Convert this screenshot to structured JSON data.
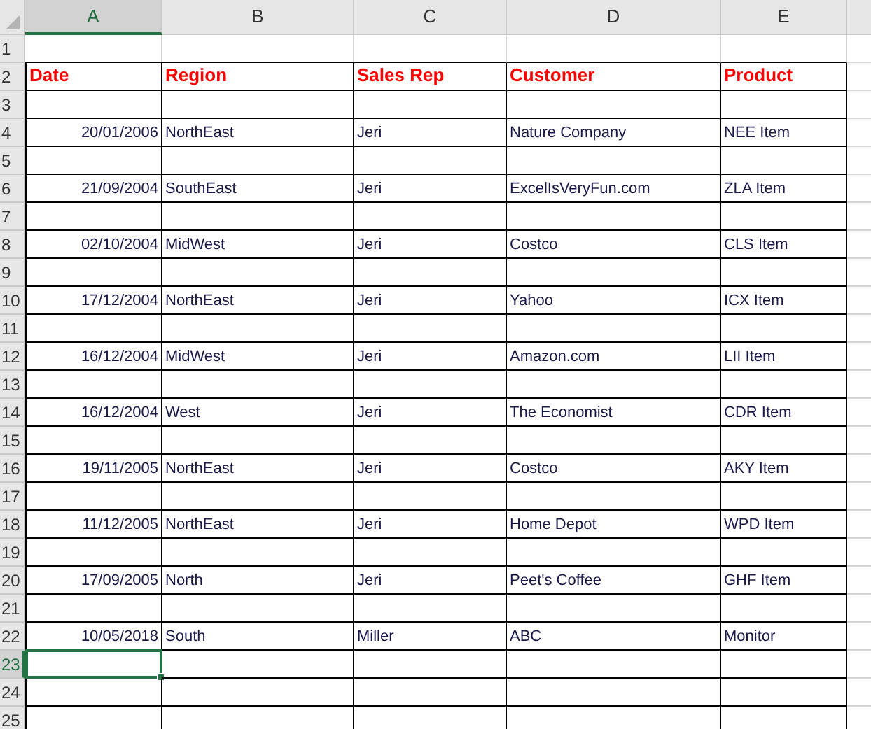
{
  "columns": [
    {
      "label": "A",
      "selected": true
    },
    {
      "label": "B",
      "selected": false
    },
    {
      "label": "C",
      "selected": false
    },
    {
      "label": "D",
      "selected": false
    },
    {
      "label": "E",
      "selected": false
    }
  ],
  "rows": [
    {
      "number": "1",
      "kind": "blank",
      "bordered": false,
      "selected": false
    },
    {
      "number": "2",
      "kind": "header",
      "bordered": true,
      "selected": false,
      "cells": [
        "Date",
        "Region",
        "Sales Rep",
        "Customer",
        "Product"
      ]
    },
    {
      "number": "3",
      "kind": "blank",
      "bordered": true,
      "selected": false
    },
    {
      "number": "4",
      "kind": "data",
      "bordered": true,
      "selected": false,
      "cells": [
        "20/01/2006",
        "NorthEast",
        "Jeri",
        "Nature Company",
        "NEE Item"
      ]
    },
    {
      "number": "5",
      "kind": "blank",
      "bordered": true,
      "selected": false
    },
    {
      "number": "6",
      "kind": "data",
      "bordered": true,
      "selected": false,
      "cells": [
        "21/09/2004",
        "SouthEast",
        "Jeri",
        "ExcelIsVeryFun.com",
        "ZLA Item"
      ]
    },
    {
      "number": "7",
      "kind": "blank",
      "bordered": true,
      "selected": false
    },
    {
      "number": "8",
      "kind": "data",
      "bordered": true,
      "selected": false,
      "cells": [
        "02/10/2004",
        "MidWest",
        "Jeri",
        "Costco",
        "CLS Item"
      ]
    },
    {
      "number": "9",
      "kind": "blank",
      "bordered": true,
      "selected": false
    },
    {
      "number": "10",
      "kind": "data",
      "bordered": true,
      "selected": false,
      "cells": [
        "17/12/2004",
        "NorthEast",
        "Jeri",
        "Yahoo",
        "ICX Item"
      ]
    },
    {
      "number": "11",
      "kind": "blank",
      "bordered": true,
      "selected": false
    },
    {
      "number": "12",
      "kind": "data",
      "bordered": true,
      "selected": false,
      "cells": [
        "16/12/2004",
        "MidWest",
        "Jeri",
        "Amazon.com",
        "LII Item"
      ]
    },
    {
      "number": "13",
      "kind": "blank",
      "bordered": true,
      "selected": false
    },
    {
      "number": "14",
      "kind": "data",
      "bordered": true,
      "selected": false,
      "cells": [
        "16/12/2004",
        "West",
        "Jeri",
        "The Economist",
        "CDR Item"
      ]
    },
    {
      "number": "15",
      "kind": "blank",
      "bordered": true,
      "selected": false
    },
    {
      "number": "16",
      "kind": "data",
      "bordered": true,
      "selected": false,
      "cells": [
        "19/11/2005",
        "NorthEast",
        "Jeri",
        "Costco",
        "AKY Item"
      ]
    },
    {
      "number": "17",
      "kind": "blank",
      "bordered": true,
      "selected": false
    },
    {
      "number": "18",
      "kind": "data",
      "bordered": true,
      "selected": false,
      "cells": [
        "11/12/2005",
        "NorthEast",
        "Jeri",
        "Home Depot",
        "WPD Item"
      ]
    },
    {
      "number": "19",
      "kind": "blank",
      "bordered": true,
      "selected": false
    },
    {
      "number": "20",
      "kind": "data",
      "bordered": true,
      "selected": false,
      "cells": [
        "17/09/2005",
        "North",
        "Jeri",
        "Peet's Coffee",
        "GHF Item"
      ]
    },
    {
      "number": "21",
      "kind": "blank",
      "bordered": true,
      "selected": false
    },
    {
      "number": "22",
      "kind": "data",
      "bordered": true,
      "selected": false,
      "cells": [
        "10/05/2018",
        "South",
        "Miller",
        "ABC",
        "Monitor"
      ]
    },
    {
      "number": "23",
      "kind": "blank",
      "bordered": true,
      "selected": true
    },
    {
      "number": "24",
      "kind": "blank",
      "bordered": true,
      "selected": false
    },
    {
      "number": "25",
      "kind": "blank",
      "bordered": true,
      "selected": false
    }
  ]
}
